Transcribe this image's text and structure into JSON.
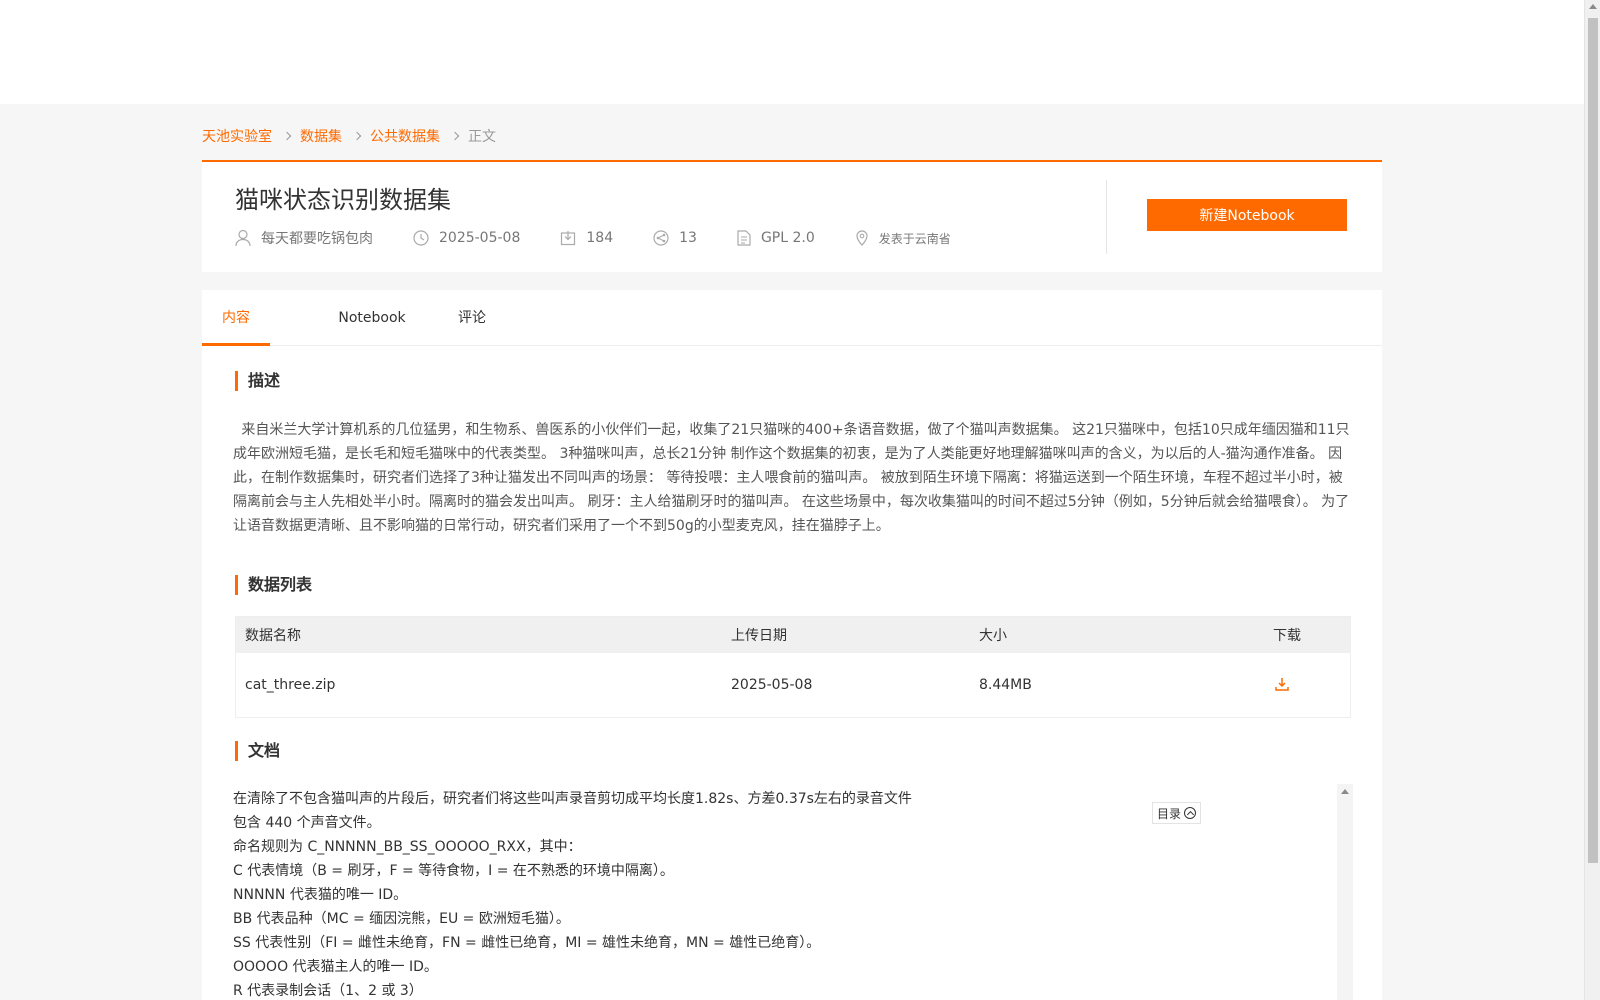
{
  "breadcrumb": {
    "items": [
      "天池实验室",
      "数据集",
      "公共数据集"
    ],
    "current": "正文"
  },
  "dataset": {
    "title": "猫咪状态识别数据集",
    "author": "每天都要吃锅包肉",
    "date": "2025-05-08",
    "downloads": "184",
    "shares": "13",
    "license": "GPL 2.0",
    "location": "发表于云南省",
    "new_notebook_label": "新建Notebook"
  },
  "tabs": [
    {
      "label": "内容",
      "active": true
    },
    {
      "label": "Notebook",
      "active": false
    },
    {
      "label": "评论",
      "active": false
    }
  ],
  "description": {
    "heading": "描述",
    "text": "来自米兰大学计算机系的几位猛男，和生物系、兽医系的小伙伴们一起，收集了21只猫咪的400+条语音数据，做了个猫叫声数据集。 这21只猫咪中，包括10只成年缅因猫和11只成年欧洲短毛猫，是长毛和短毛猫咪中的代表类型。 3种猫咪叫声，总长21分钟 制作这个数据集的初衷，是为了人类能更好地理解猫咪叫声的含义，为以后的人-猫沟通作准备。 因此，在制作数据集时，研究者们选择了3种让猫发出不同叫声的场景： 等待投喂：主人喂食前的猫叫声。 被放到陌生环境下隔离：将猫运送到一个陌生环境，车程不超过半小时，被隔离前会与主人先相处半小时。隔离时的猫会发出叫声。 刷牙：主人给猫刷牙时的猫叫声。 在这些场景中，每次收集猫叫的时间不超过5分钟（例如，5分钟后就会给猫喂食）。 为了让语音数据更清晰、且不影响猫的日常行动，研究者们采用了一个不到50g的小型麦克风，挂在猫脖子上。"
  },
  "data_list": {
    "heading": "数据列表",
    "columns": [
      "数据名称",
      "上传日期",
      "大小",
      "下载"
    ],
    "rows": [
      {
        "name": "cat_three.zip",
        "date": "2025-05-08",
        "size": "8.44MB"
      }
    ]
  },
  "docs": {
    "heading": "文档",
    "toc_label": "目录",
    "lines": [
      "在清除了不包含猫叫声的片段后，研究者们将这些叫声录音剪切成平均长度1.82s、方差0.37s左右的录音文件",
      "包含 440 个声音文件。",
      "命名规则为 C_NNNNN_BB_SS_OOOOO_RXX，其中：",
      "C 代表情境（B = 刷牙，F = 等待食物，I = 在不熟悉的环境中隔离）。",
      "NNNNN 代表猫的唯一 ID。",
      "BB 代表品种（MC = 缅因浣熊，EU = 欧洲短毛猫）。",
      "SS 代表性别（FI = 雌性未绝育，FN = 雌性已绝育，MI = 雄性未绝育，MN = 雄性已绝育）。",
      "OOOOO 代表猫主人的唯一 ID。",
      "R 代表录制会话（1、2 或 3）"
    ]
  },
  "colors": {
    "accent": "#ff6a00"
  },
  "icons": [
    "user-icon",
    "clock-icon",
    "download-count-icon",
    "share-icon",
    "license-icon",
    "location-pin-icon",
    "download-icon"
  ]
}
